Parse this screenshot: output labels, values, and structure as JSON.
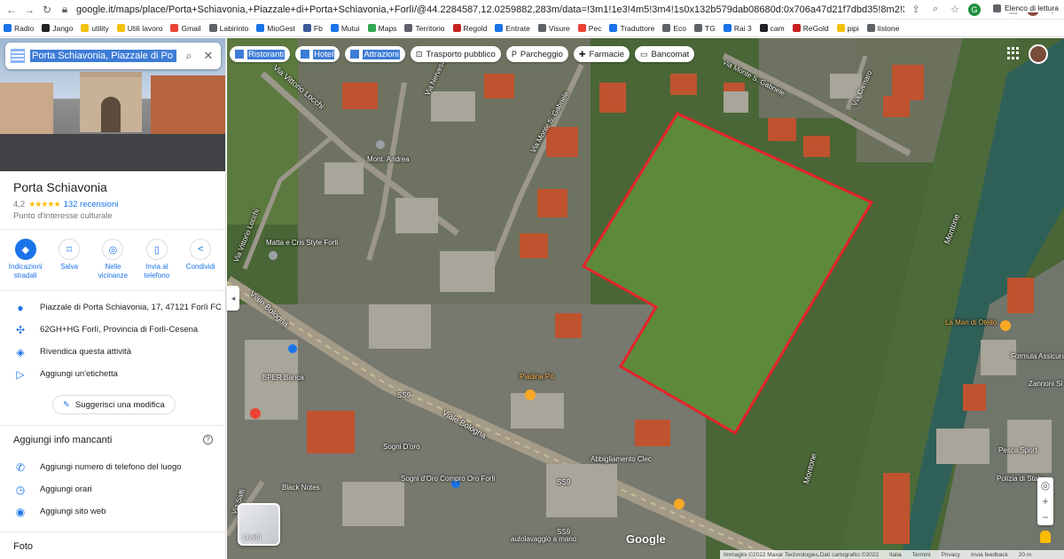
{
  "browser": {
    "url_host": "google.it",
    "url_path": "/maps/place/Porta+Schiavonia,+Piazzale+di+Porta+Schiavonia,+Forlì/@44.2284587,12.0259882,283m/data=!3m1!1e3!4m5!3m4!1s0x132b579dab08680d:0x706a47d21f7dbd35!8m2!3d44.22649!4d12.02882",
    "bookmarks": [
      {
        "label": "Radio",
        "color": "#1a73e8"
      },
      {
        "label": "Jango",
        "color": "#222222"
      },
      {
        "label": "utility",
        "color": "#f4c20d"
      },
      {
        "label": "Utili lavoro",
        "color": "#f4c20d"
      },
      {
        "label": "Gmail",
        "color": "#ea4335"
      },
      {
        "label": "Labirinto",
        "color": "#5f6368"
      },
      {
        "label": "MioGest",
        "color": "#1a73e8"
      },
      {
        "label": "Fb",
        "color": "#3b5998"
      },
      {
        "label": "Mutui",
        "color": "#1a73e8"
      },
      {
        "label": "Maps",
        "color": "#34a853"
      },
      {
        "label": "Territorio",
        "color": "#5f6368"
      },
      {
        "label": "Regold",
        "color": "#c5221f"
      },
      {
        "label": "Entrate",
        "color": "#1a73e8"
      },
      {
        "label": "Visure",
        "color": "#5f6368"
      },
      {
        "label": "Pec",
        "color": "#ea4335"
      },
      {
        "label": "Traduttore",
        "color": "#1a73e8"
      },
      {
        "label": "Eco",
        "color": "#5f6368"
      },
      {
        "label": "TG",
        "color": "#5f6368"
      },
      {
        "label": "Rai 3",
        "color": "#1a73e8"
      },
      {
        "label": "cam",
        "color": "#202124"
      },
      {
        "label": "ReGold",
        "color": "#c5221f"
      },
      {
        "label": "pipi",
        "color": "#f4c20d"
      },
      {
        "label": "listone",
        "color": "#5f6368"
      }
    ],
    "reading_list": "Elenco di lettura"
  },
  "search": {
    "value": "Porta Schiavonia, Piazzale di Po"
  },
  "place": {
    "title": "Porta Schiavonia",
    "rating": "4,2",
    "stars": "★★★★★",
    "reviews": "132 recensioni",
    "category": "Punto d'interesse culturale"
  },
  "actions": [
    {
      "label": "Indicazioni stradali",
      "icon": "◆"
    },
    {
      "label": "Salva",
      "icon": "⌑"
    },
    {
      "label": "Nelle vicinanze",
      "icon": "◎"
    },
    {
      "label": "Invia al telefono",
      "icon": "▯"
    },
    {
      "label": "Condividi",
      "icon": "<"
    }
  ],
  "info": [
    {
      "text": "Piazzale di Porta Schiavonia, 17, 47121 Forlì FC",
      "icon": "●"
    },
    {
      "text": "62GH+HG Forlì, Provincia di Forlì-Cesena",
      "icon": "✣"
    },
    {
      "text": "Rivendica questa attività",
      "icon": "◈"
    },
    {
      "text": "Aggiungi un'etichetta",
      "icon": "▷"
    }
  ],
  "suggest_edit": "Suggerisci una modifica",
  "missing": {
    "title": "Aggiungi info mancanti",
    "help": "?",
    "items": [
      {
        "text": "Aggiungi numero di telefono del luogo",
        "icon": "✆"
      },
      {
        "text": "Aggiungi orari",
        "icon": "◷"
      },
      {
        "text": "Aggiungi sito web",
        "icon": "◉"
      }
    ]
  },
  "photos_title": "Foto",
  "chips": [
    {
      "label": "Ristoranti",
      "selected": true,
      "icon": ""
    },
    {
      "label": "Hotel",
      "selected": true,
      "icon": ""
    },
    {
      "label": "Attrazioni",
      "selected": true,
      "icon": ""
    },
    {
      "label": "Trasporto pubblico",
      "selected": false,
      "icon": "⊡"
    },
    {
      "label": "Parcheggio",
      "selected": false,
      "icon": "P"
    },
    {
      "label": "Farmacie",
      "selected": false,
      "icon": "✚"
    },
    {
      "label": "Bancomat",
      "selected": false,
      "icon": "▭"
    }
  ],
  "map_labels": {
    "via_vittorio_locchi_top": "Via Vittorio Locchi",
    "via_nervesa": "Via Nervesa",
    "via_monte_s_gabriele_1": "Via Monte S. Gabriele",
    "via_monte_s_gabriele_2": "Via Monte S. Gabriele",
    "via_carnaro": "Via Carnaro",
    "monte_andrea": "Mont. Andrea",
    "via_vittorio_locchi_left": "Via Vittorio Locchi",
    "matta_cris": "Matta e Cris Style Forlì",
    "viale_bologna_1": "Viale Bologna",
    "viale_bologna_2": "Viale Bologna",
    "bper": "BPER Banca",
    "piadina": "Piadina Pit",
    "montone_1": "Montone",
    "montone_2": "Montone",
    "la_mari": "La Mari di Otello",
    "formula": "Formula Assicura",
    "zannoni": "Zannoni Si",
    "pesca": "Pesca Sport",
    "polizia": "Polizia di Stato",
    "abbigliamento": "Abbigliamento Clec",
    "sogni_oro_1": "Sogni D'oro",
    "sogni_oro_2": "Sogni d'Oro Compro Oro Forlì",
    "black_notes": "Black Notes",
    "autolavaggio": "autolavaggio a mano",
    "ss9_1": "SS9",
    "ss9_2": "SS9",
    "ss9_3": "SS9",
    "via_saffi": "Via Saffi"
  },
  "layers_label": "Livelli",
  "google_logo": "Google",
  "zoom": {
    "plus": "+",
    "minus": "−"
  },
  "attribution": {
    "imagery": "Immagini ©2022 Maxar Technologies,Dati cartografici ©2022",
    "country": "Italia",
    "terms": "Termini",
    "privacy": "Privacy",
    "feedback": "Invia feedback",
    "scale": "20 m"
  },
  "colors": {
    "accent": "#1a73e8",
    "boundary": "#e5232b",
    "selection": "#3d7cd6"
  }
}
